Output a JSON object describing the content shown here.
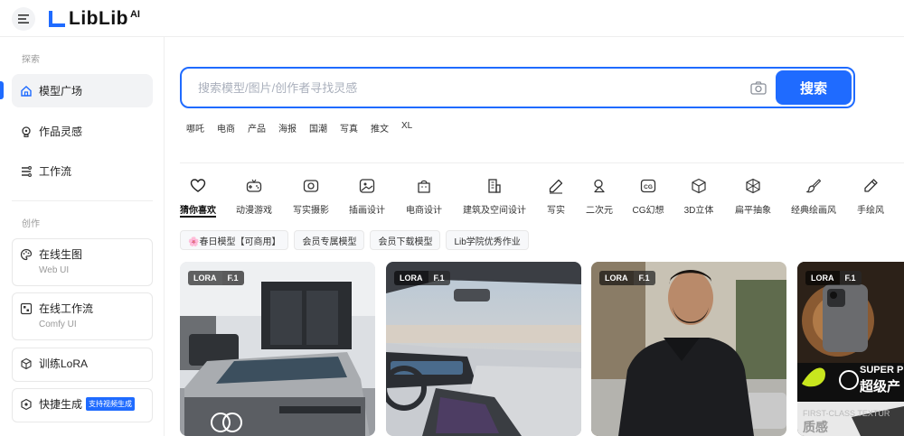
{
  "header": {
    "logo_text": "LibLib",
    "logo_ai": "AI",
    "menu_icon": "menu-icon"
  },
  "sidebar": {
    "explore_label": "探索",
    "nav": [
      {
        "label": "模型广场",
        "icon": "home-icon",
        "active": true
      },
      {
        "label": "作品灵感",
        "icon": "bulb-icon",
        "active": false
      },
      {
        "label": "工作流",
        "icon": "workflow-icon",
        "active": false
      }
    ],
    "create_label": "创作",
    "cards": [
      {
        "label": "在线生图",
        "sub": "Web UI",
        "icon": "palette-icon"
      },
      {
        "label": "在线工作流",
        "sub": "Comfy UI",
        "icon": "comfy-icon"
      },
      {
        "label": "训练LoRA",
        "icon": "cube-icon"
      },
      {
        "label": "快捷生成",
        "badge": "支持视频生成",
        "icon": "hexagon-icon"
      }
    ]
  },
  "search": {
    "placeholder": "搜索模型/图片/创作者寻找灵感",
    "button_label": "搜索",
    "camera_icon": "camera-icon"
  },
  "hot_tags": [
    "哪吒",
    "电商",
    "产品",
    "海报",
    "国潮",
    "写真",
    "推文",
    "XL"
  ],
  "categories": [
    {
      "label": "猜你喜欢",
      "icon": "heart-icon",
      "active": true
    },
    {
      "label": "动漫游戏",
      "icon": "gamepad-icon"
    },
    {
      "label": "写实摄影",
      "icon": "camera-lens-icon"
    },
    {
      "label": "插画设计",
      "icon": "image-icon"
    },
    {
      "label": "电商设计",
      "icon": "bag-icon"
    },
    {
      "label": "建筑及空间设计",
      "icon": "building-icon"
    },
    {
      "label": "写实",
      "icon": "pen-icon"
    },
    {
      "label": "二次元",
      "icon": "shapes-icon"
    },
    {
      "label": "CG幻想",
      "icon": "cg-icon"
    },
    {
      "label": "3D立体",
      "icon": "cube3d-icon"
    },
    {
      "label": "扁平抽象",
      "icon": "flat-cube-icon"
    },
    {
      "label": "经典绘画风",
      "icon": "brush-icon"
    },
    {
      "label": "手绘风",
      "icon": "pencil-icon"
    }
  ],
  "pills": [
    "🌸春日模型【可商用】",
    "会员专属模型",
    "会员下载模型",
    "Lib学院优秀作业"
  ],
  "model_cards": [
    {
      "tag1": "LORA",
      "tag2": "F.1"
    },
    {
      "tag1": "LORA",
      "tag2": "F.1"
    },
    {
      "tag1": "LORA",
      "tag2": "F.1"
    },
    {
      "tag1": "LORA",
      "tag2": "F.1",
      "text1": "SUPER P",
      "text2": "超级产",
      "text3": "FIRST-CLASS TEXTUR",
      "text4": "质感"
    }
  ],
  "colors": {
    "accent": "#1f6bff"
  }
}
